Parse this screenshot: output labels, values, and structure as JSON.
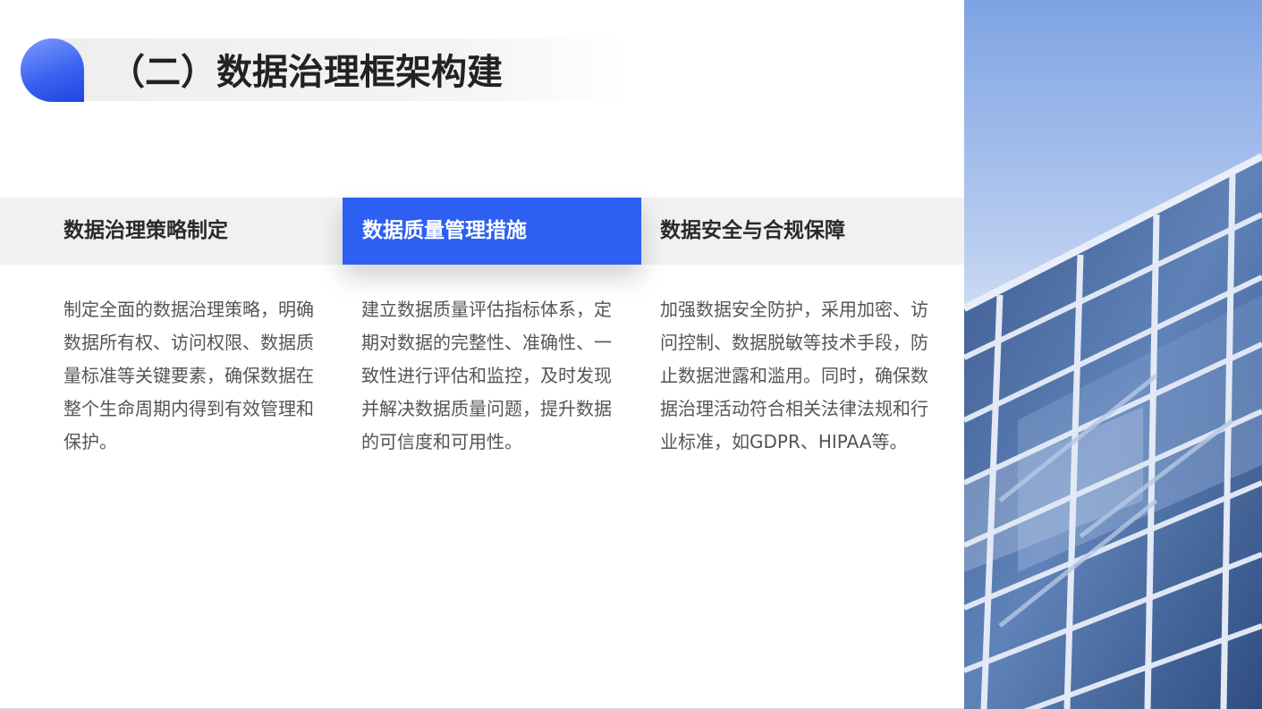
{
  "title": "（二）数据治理框架构建",
  "tabs": [
    {
      "label": "数据治理策略制定",
      "active": false
    },
    {
      "label": "数据质量管理措施",
      "active": true
    },
    {
      "label": "数据安全与合规保障",
      "active": false
    }
  ],
  "paragraphs": [
    "制定全面的数据治理策略，明确数据所有权、访问权限、数据质量标准等关键要素，确保数据在整个生命周期内得到有效管理和保护。",
    "建立数据质量评估指标体系，定期对数据的完整性、准确性、一致性进行评估和监控，及时发现并解决数据质量问题，提升数据的可信度和可用性。",
    "加强数据安全防护，采用加密、访问控制、数据脱敏等技术手段，防止数据泄露和滥用。同时，确保数据治理活动符合相关法律法规和行业标准，如GDPR、HIPAA等。"
  ],
  "colors": {
    "accent": "#2c5ff2",
    "tab_bg": "#f1f1f1",
    "title_text": "#222222",
    "body_text": "#555555"
  },
  "image": {
    "subject": "glass-building-photo"
  }
}
